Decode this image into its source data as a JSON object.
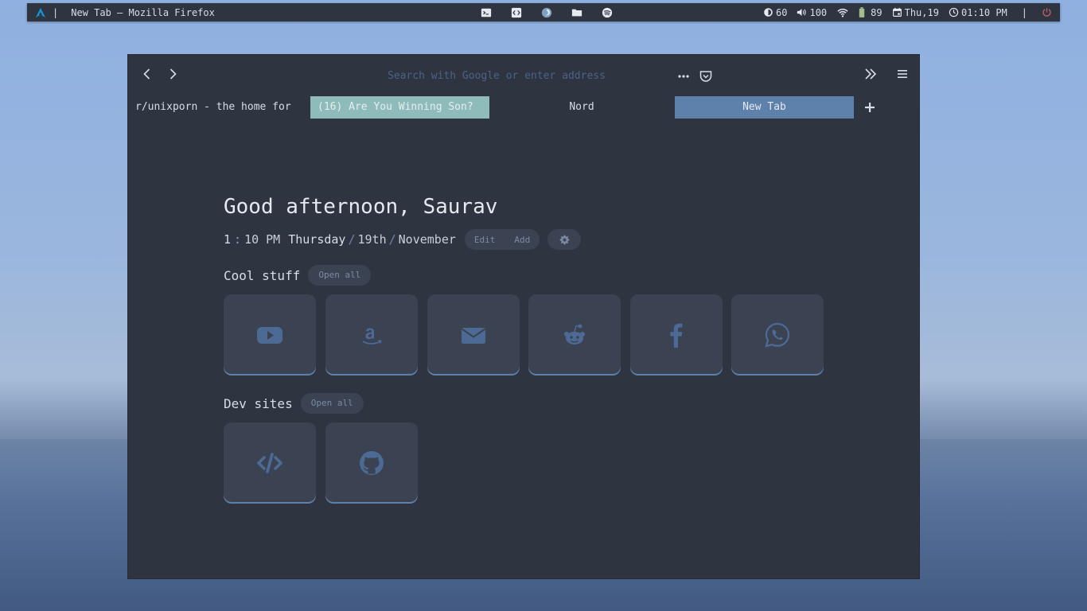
{
  "topbar": {
    "window_title": "New Tab — Mozilla Firefox",
    "separator": "|",
    "brightness": "60",
    "volume": "100",
    "battery": "89",
    "date": "Thu,19",
    "time": "01:10 PM",
    "separator_right": "|",
    "icons": [
      "terminal-icon",
      "code-editor-icon",
      "firefox-icon",
      "folder-icon",
      "spotify-icon"
    ],
    "power_color": "#bf616a"
  },
  "browser": {
    "url_placeholder": "Search with Google or enter address",
    "tabs": [
      {
        "label": "r/unixporn - the home for"
      },
      {
        "label": "(16) Are You Winning Son?"
      },
      {
        "label": "Nord"
      },
      {
        "label": "New Tab"
      }
    ]
  },
  "page": {
    "greeting": "Good afternoon, Saurav",
    "time_hour": "1",
    "time_colon": ":",
    "time_rest": "10 PM",
    "weekday": "Thursday",
    "day": "19th",
    "month": "November",
    "slash": "/",
    "edit_label": "Edit",
    "add_label": "Add",
    "sections": [
      {
        "title": "Cool stuff",
        "open_all": "Open all",
        "links": [
          "youtube-icon",
          "amazon-icon",
          "mail-icon",
          "reddit-icon",
          "facebook-icon",
          "whatsapp-icon"
        ]
      },
      {
        "title": "Dev sites",
        "open_all": "Open all",
        "links": [
          "code-icon",
          "github-icon"
        ]
      }
    ]
  },
  "colors": {
    "background": "#2e3440",
    "card": "#3b4252",
    "accent": "#5e81ac",
    "icon": "#4c6a94",
    "tab_active": "#5e81ac",
    "tab_highlight": "#8fbcbb"
  }
}
